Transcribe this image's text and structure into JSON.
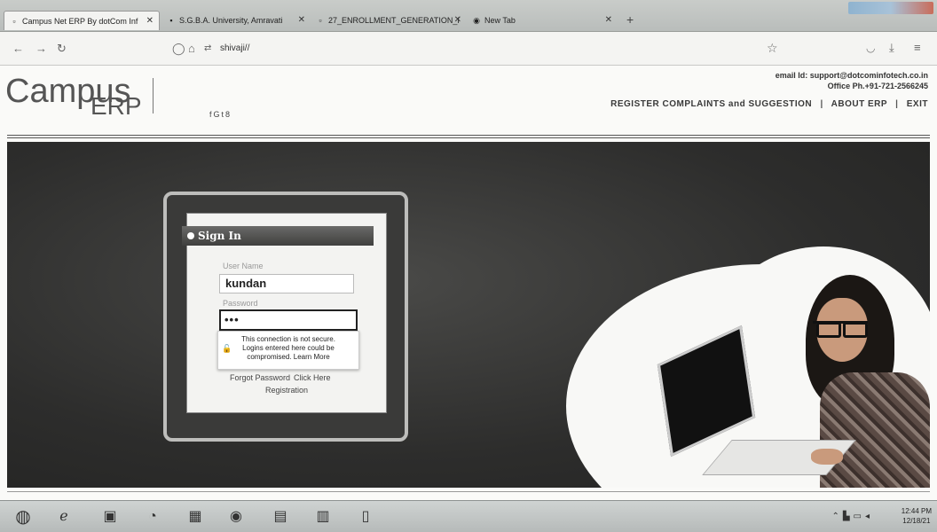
{
  "browser": {
    "tabs": [
      {
        "label": "Campus Net ERP By dotCom Inf",
        "icon": "page-icon"
      },
      {
        "label": "S.G.B.A. University, Amravati",
        "icon": "university-icon"
      },
      {
        "label": "27_ENROLLMENT_GENERATION_I",
        "icon": "page-icon"
      },
      {
        "label": "New Tab",
        "icon": "firefox-icon"
      }
    ],
    "new_tab_label": "+",
    "url": "shivaji//"
  },
  "header": {
    "logo_campus": "Campus",
    "logo_erp": "ERP",
    "social": "fGt8",
    "email": "email Id: support@dotcominfotech.co.in",
    "phone": "Office Ph.+91-721-2566245",
    "nav": {
      "complaints": "REGISTER COMPLAINTS and SUGGESTION",
      "about": "ABOUT ERP",
      "exit": "EXIT",
      "separator": "|"
    }
  },
  "login": {
    "title": "Sign In",
    "username_label": "User Name",
    "username_value": "kundan",
    "password_label": "Password",
    "password_value": "•••",
    "warning_line1": "This connection is not secure.",
    "warning_line2": "Logins entered here could be",
    "warning_line3": "compromised. Learn More",
    "forgot_text": "Forgot Password",
    "forgot_click": "Click Here",
    "registration": "Registration"
  },
  "taskbar": {
    "clock_time": "12:44 PM",
    "clock_date": "12/18/21"
  }
}
